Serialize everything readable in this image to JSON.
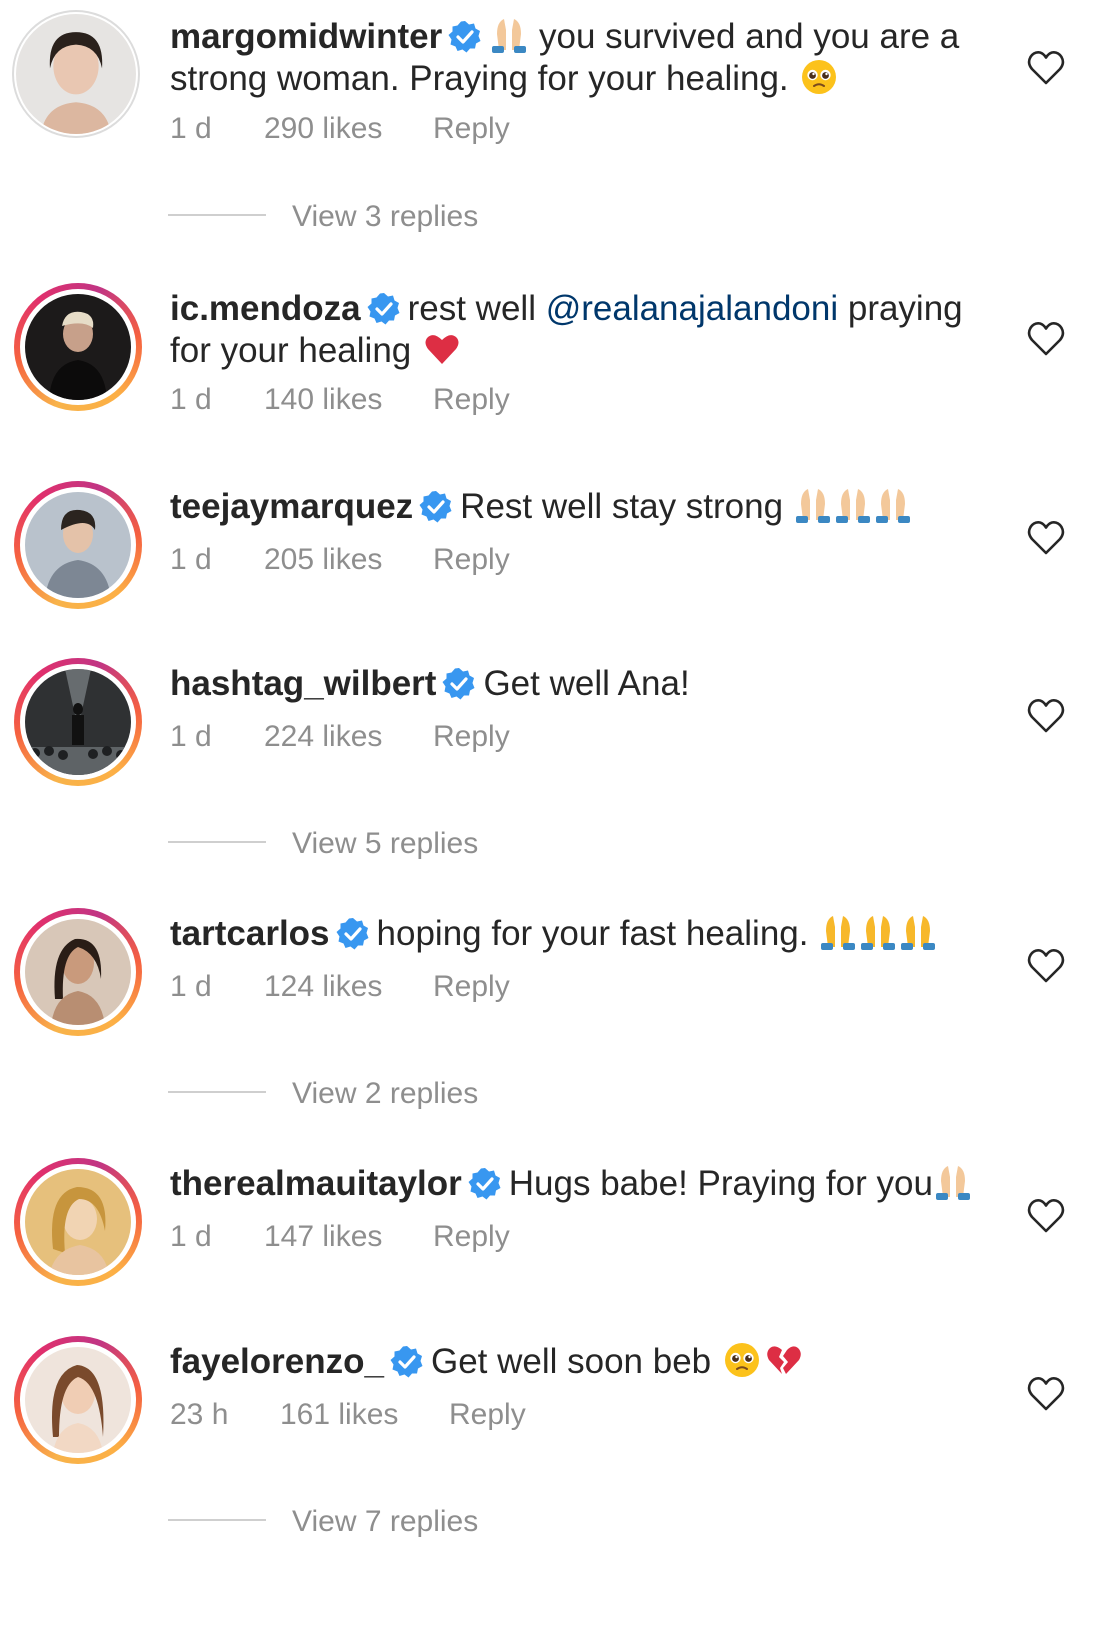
{
  "colors": {
    "text": "#262626",
    "meta": "#8e8e8e",
    "mention": "#00376b",
    "verified": "#3897f0",
    "like_heart": "#262626"
  },
  "comments": [
    {
      "username": "margomidwinter",
      "verified": true,
      "text_parts": [
        "you survived and you are a strong woman. Praying for your healing."
      ],
      "time": "1 d",
      "likes": "290 likes",
      "reply": "Reply",
      "view_replies": "View 3 replies"
    },
    {
      "username": "ic.mendoza",
      "verified": true,
      "text_parts": [
        "rest well ",
        "@realanajalandoni",
        " praying for your healing"
      ],
      "time": "1 d",
      "likes": "140 likes",
      "reply": "Reply"
    },
    {
      "username": "teejaymarquez",
      "verified": true,
      "text_parts": [
        "Rest well stay strong"
      ],
      "time": "1 d",
      "likes": "205 likes",
      "reply": "Reply"
    },
    {
      "username": "hashtag_wilbert",
      "verified": true,
      "text_parts": [
        "Get well Ana!"
      ],
      "time": "1 d",
      "likes": "224 likes",
      "reply": "Reply",
      "view_replies": "View 5 replies"
    },
    {
      "username": "tartcarlos",
      "verified": true,
      "text_parts": [
        "hoping for your fast healing."
      ],
      "time": "1 d",
      "likes": "124 likes",
      "reply": "Reply",
      "view_replies": "View 2 replies"
    },
    {
      "username": "therealmauitaylor",
      "verified": true,
      "text_parts": [
        "Hugs babe! Praying for you"
      ],
      "time": "1 d",
      "likes": "147 likes",
      "reply": "Reply"
    },
    {
      "username": "fayelorenzo_",
      "verified": true,
      "text_parts": [
        "Get well soon beb"
      ],
      "time": "23 h",
      "likes": "161 likes",
      "reply": "Reply",
      "view_replies": "View 7 replies"
    }
  ]
}
